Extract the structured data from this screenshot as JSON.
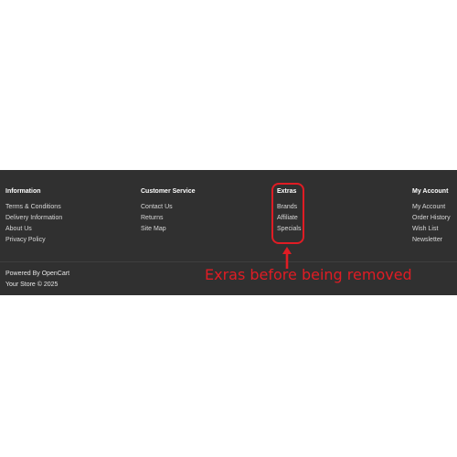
{
  "footer": {
    "columns": [
      {
        "heading": "Information",
        "links": [
          "Terms & Conditions",
          "Delivery Information",
          "About Us",
          "Privacy Policy"
        ]
      },
      {
        "heading": "Customer Service",
        "links": [
          "Contact Us",
          "Returns",
          "Site Map"
        ]
      },
      {
        "heading": "Extras",
        "links": [
          "Brands",
          "Affiliate",
          "Specials"
        ]
      },
      {
        "heading": "My Account",
        "links": [
          "My Account",
          "Order History",
          "Wish List",
          "Newsletter"
        ]
      }
    ],
    "powered_by_prefix": "Powered By ",
    "powered_by_link": "OpenCart",
    "copyright": "Your Store © 2025"
  },
  "annotation": {
    "text": "Exras before being removed"
  },
  "colors": {
    "footer_bg": "#303030",
    "annotation_red": "#e01c24"
  }
}
